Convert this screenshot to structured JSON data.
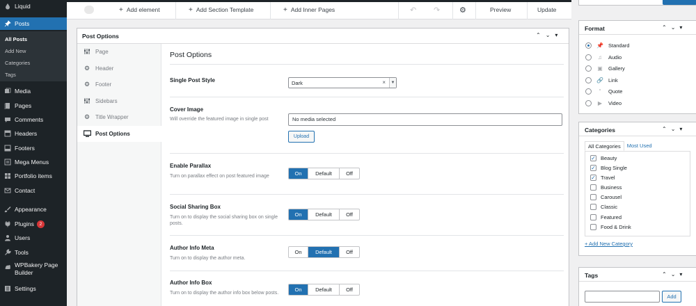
{
  "admin_menu": {
    "items": [
      {
        "label": "Liquid",
        "icon": "liquid-icon"
      },
      {
        "label": "Posts",
        "icon": "pin-icon",
        "current": true
      },
      {
        "label": "Media",
        "icon": "media-icon"
      },
      {
        "label": "Pages",
        "icon": "pages-icon"
      },
      {
        "label": "Comments",
        "icon": "comments-icon"
      },
      {
        "label": "Headers",
        "icon": "headers-icon"
      },
      {
        "label": "Footers",
        "icon": "footers-icon"
      },
      {
        "label": "Mega Menus",
        "icon": "mega-menus-icon"
      },
      {
        "label": "Portfolio items",
        "icon": "portfolio-icon"
      },
      {
        "label": "Contact",
        "icon": "contact-icon"
      },
      {
        "label": "Appearance",
        "icon": "appearance-icon"
      },
      {
        "label": "Plugins",
        "icon": "plugins-icon",
        "badge": "2"
      },
      {
        "label": "Users",
        "icon": "users-icon"
      },
      {
        "label": "Tools",
        "icon": "tools-icon"
      },
      {
        "label": "WPBakery Page",
        "label2": "Builder",
        "icon": "wpbakery-icon"
      },
      {
        "label": "Settings",
        "icon": "settings-icon"
      }
    ],
    "submenu": [
      "All Posts",
      "Add New",
      "Categories",
      "Tags"
    ]
  },
  "toolbar": {
    "add_element": "Add element",
    "add_section_template": "Add Section Template",
    "add_inner_pages": "Add Inner Pages",
    "preview": "Preview",
    "update": "Update"
  },
  "post_options": {
    "box_title": "Post Options",
    "tabs": [
      {
        "label": "Page",
        "icon": "sliders-icon"
      },
      {
        "label": "Header",
        "icon": "gear-icon"
      },
      {
        "label": "Footer",
        "icon": "gear-icon"
      },
      {
        "label": "Sidebars",
        "icon": "sliders-icon"
      },
      {
        "label": "Title Wrapper",
        "icon": "gear-icon"
      },
      {
        "label": "Post Options",
        "icon": "monitor-icon",
        "active": true
      }
    ],
    "section_title": "Post Options",
    "single_post_style": {
      "label": "Single Post Style",
      "value": "Dark"
    },
    "cover_image": {
      "label": "Cover Image",
      "desc": "Will override the featured image in single post",
      "value": "No media selected",
      "button": "Upload"
    },
    "toggles": [
      {
        "label": "Enable Parallax",
        "desc": "Turn on parallax effect on post featured image",
        "selected": "On"
      },
      {
        "label": "Social Sharing Box",
        "desc": "Turn on to display the social sharing box on single posts.",
        "selected": "On"
      },
      {
        "label": "Author Info Meta",
        "desc": "Turn on to display the author meta.",
        "selected": "Default"
      },
      {
        "label": "Author Info Box",
        "desc": "Turn on to display the author info box below posts.",
        "selected": "On"
      }
    ],
    "toggle_options": {
      "on": "On",
      "default": "Default",
      "off": "Off"
    }
  },
  "format_box": {
    "title": "Format",
    "options": [
      {
        "label": "Standard",
        "icon": "pin-icon",
        "checked": true
      },
      {
        "label": "Audio",
        "icon": "music-icon"
      },
      {
        "label": "Gallery",
        "icon": "gallery-icon"
      },
      {
        "label": "Link",
        "icon": "link-icon"
      },
      {
        "label": "Quote",
        "icon": "quote-icon"
      },
      {
        "label": "Video",
        "icon": "video-icon"
      }
    ]
  },
  "categories_box": {
    "title": "Categories",
    "tab_all": "All Categories",
    "tab_most_used": "Most Used",
    "items": [
      {
        "label": "Beauty",
        "checked": true
      },
      {
        "label": "Blog Single",
        "checked": true
      },
      {
        "label": "Travel",
        "checked": true
      },
      {
        "label": "Business",
        "checked": false
      },
      {
        "label": "Carousel",
        "checked": false
      },
      {
        "label": "Classic",
        "checked": false
      },
      {
        "label": "Featured",
        "checked": false
      },
      {
        "label": "Food & Drink",
        "checked": false
      }
    ],
    "add_new": "+ Add New Category"
  },
  "tags_box": {
    "title": "Tags",
    "add_button": "Add"
  },
  "colors": {
    "admin_bg": "#1d2327",
    "accent": "#2271b1",
    "badge": "#d63638"
  }
}
